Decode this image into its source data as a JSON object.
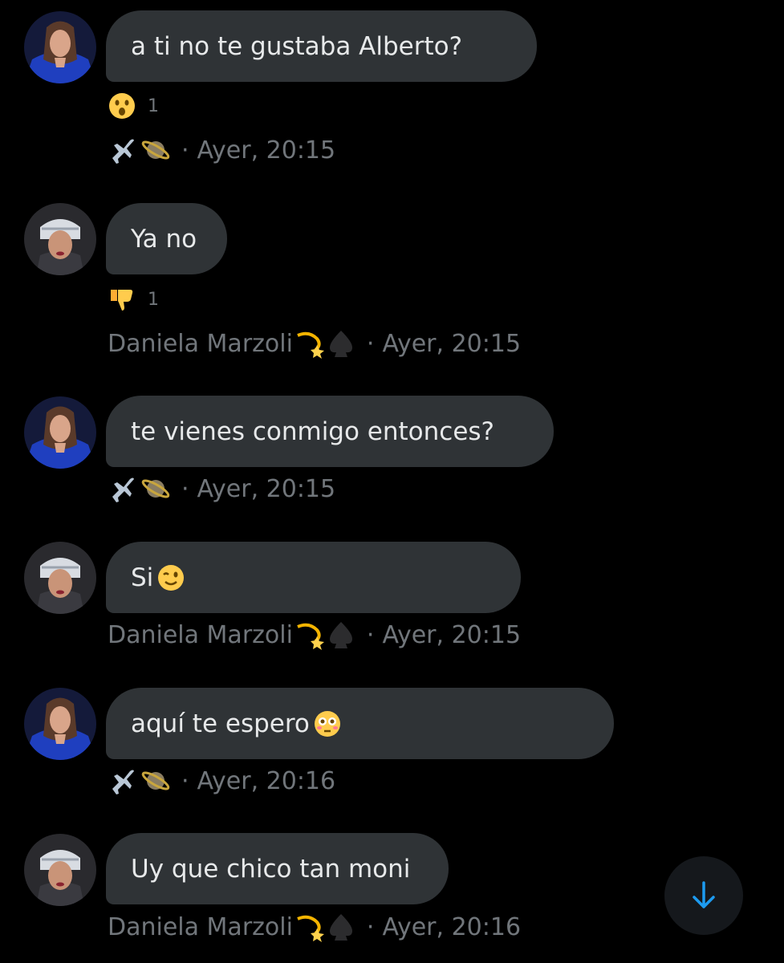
{
  "messages": [
    {
      "text": "a ti no te gustaba Alberto?",
      "sender_display": "",
      "time": "Ayer, 20:15",
      "reaction": {
        "emoji": "astonished-face",
        "count": "1"
      }
    },
    {
      "text": "Ya no",
      "sender_display": "Daniela Marzoli",
      "time": "Ayer, 20:15",
      "reaction": {
        "emoji": "thumbs-down",
        "count": "1"
      }
    },
    {
      "text": "te vienes conmigo entonces?",
      "sender_display": "",
      "time": "Ayer, 20:15"
    },
    {
      "text": "Si",
      "sender_display": "Daniela Marzoli",
      "time": "Ayer, 20:15",
      "inline_emoji": "winking-face"
    },
    {
      "text": "aquí te espero ",
      "sender_display": "",
      "time": "Ayer, 20:16",
      "inline_emoji": "flushed-face"
    },
    {
      "text": "Uy que chico tan moni",
      "sender_display": "Daniela Marzoli",
      "time": "Ayer, 20:16"
    }
  ],
  "separator": "·",
  "sender_a_icons": [
    "airplane-icon",
    "ringed-planet-icon"
  ],
  "sender_b_icons": [
    "dizzy-icon",
    "spade-suit-icon"
  ],
  "scroll_button": {
    "icon": "arrow-down-icon",
    "color": "#1d9bf0"
  },
  "colors": {
    "background": "#000000",
    "bubble": "#2f3336",
    "text": "#e7e9ea",
    "meta": "#71767b",
    "accent": "#1d9bf0"
  }
}
